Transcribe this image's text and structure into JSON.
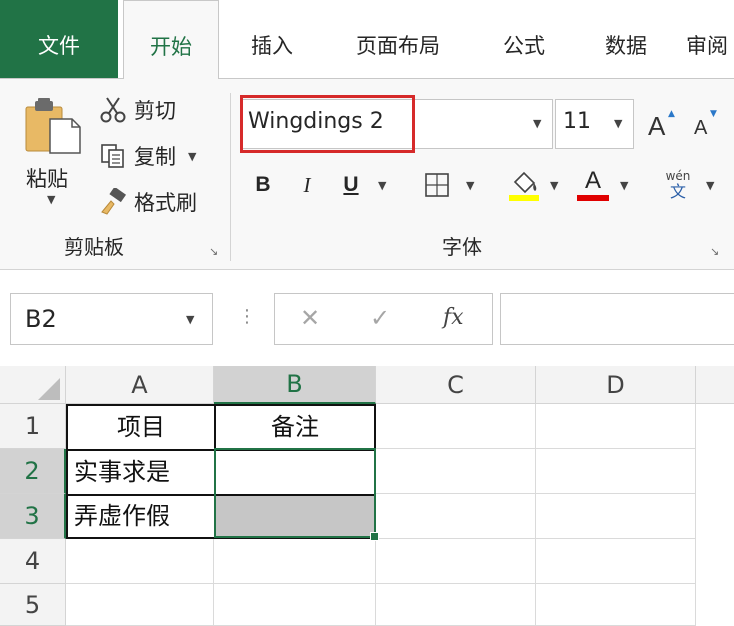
{
  "tabs": [
    {
      "label": "文件"
    },
    {
      "label": "开始"
    },
    {
      "label": "插入"
    },
    {
      "label": "页面布局"
    },
    {
      "label": "公式"
    },
    {
      "label": "数据"
    },
    {
      "label": "审阅"
    }
  ],
  "active_tab": "开始",
  "clipboard": {
    "paste": "粘贴",
    "cut": "剪切",
    "copy": "复制",
    "format_painter": "格式刷",
    "group_label": "剪贴板"
  },
  "font": {
    "name": "Wingdings 2",
    "size": "11",
    "grow": "A",
    "shrink": "A",
    "bold": "B",
    "italic": "I",
    "underline": "U",
    "font_color_letter": "A",
    "phonetic_top": "wén",
    "phonetic_bottom": "文",
    "group_label": "字体",
    "fill_color": "#ffff00",
    "font_color": "#e00000"
  },
  "formula_bar": {
    "name_box": "B2",
    "cancel": "✕",
    "enter": "✓",
    "fx": "fx",
    "value": ""
  },
  "sheet": {
    "columns": [
      "A",
      "B",
      "C",
      "D"
    ],
    "rows": [
      "1",
      "2",
      "3",
      "4",
      "5"
    ],
    "cells": {
      "A1": "项目",
      "B1": "备注",
      "A2": "实事求是",
      "A3": "弄虚作假",
      "B2": "",
      "B3": ""
    },
    "selected_range": "B2:B3",
    "accent": "#217346"
  }
}
